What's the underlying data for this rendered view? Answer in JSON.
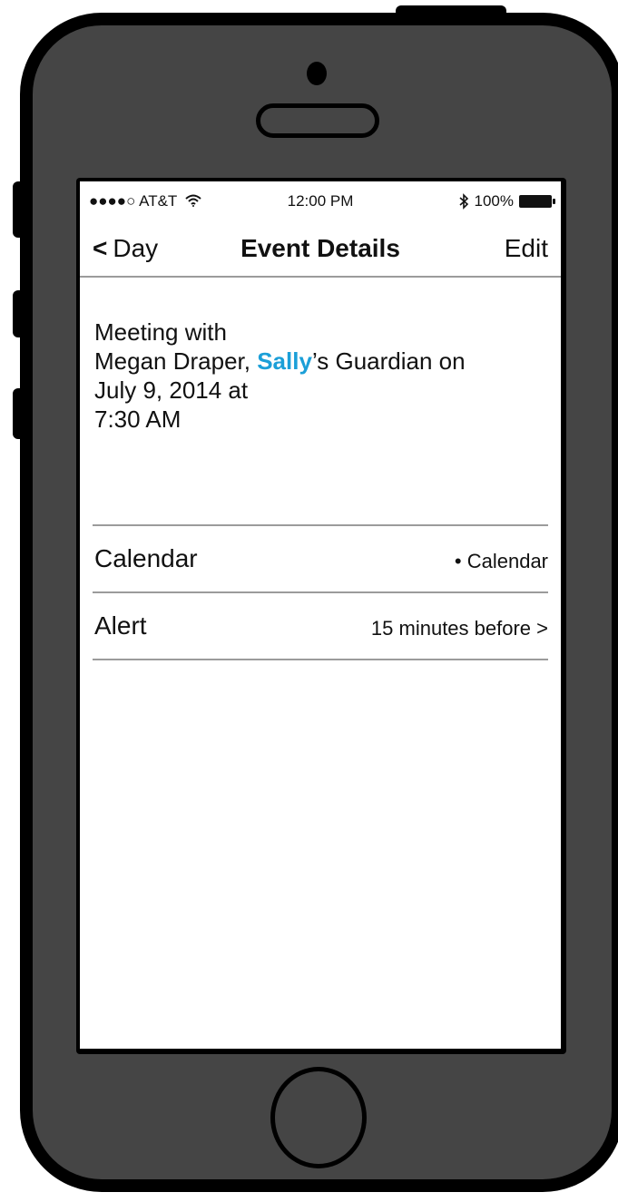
{
  "status_bar": {
    "carrier": "●●●●○ AT&T",
    "wifi_icon": "wifi-icon",
    "time": "12:00 PM",
    "bluetooth_icon": "bluetooth-icon",
    "battery_percent": "100%"
  },
  "nav": {
    "back_label": "Day",
    "back_chevron": "<",
    "title": "Event Details",
    "edit_label": "Edit"
  },
  "event": {
    "line1": "Meeting with",
    "line2_prefix": "Megan Draper, ",
    "line2_highlight": "Sally",
    "line2_suffix": "’s Guardian on",
    "line3": "July 9, 2014 at",
    "line4": "7:30 AM"
  },
  "details": {
    "calendar_label": "Calendar",
    "calendar_value": "• Calendar",
    "alert_label": "Alert",
    "alert_value": "15 minutes before >"
  },
  "colors": {
    "accent": "#1b9fd8",
    "phone_body": "#454545",
    "divider": "#9b9b9b"
  }
}
